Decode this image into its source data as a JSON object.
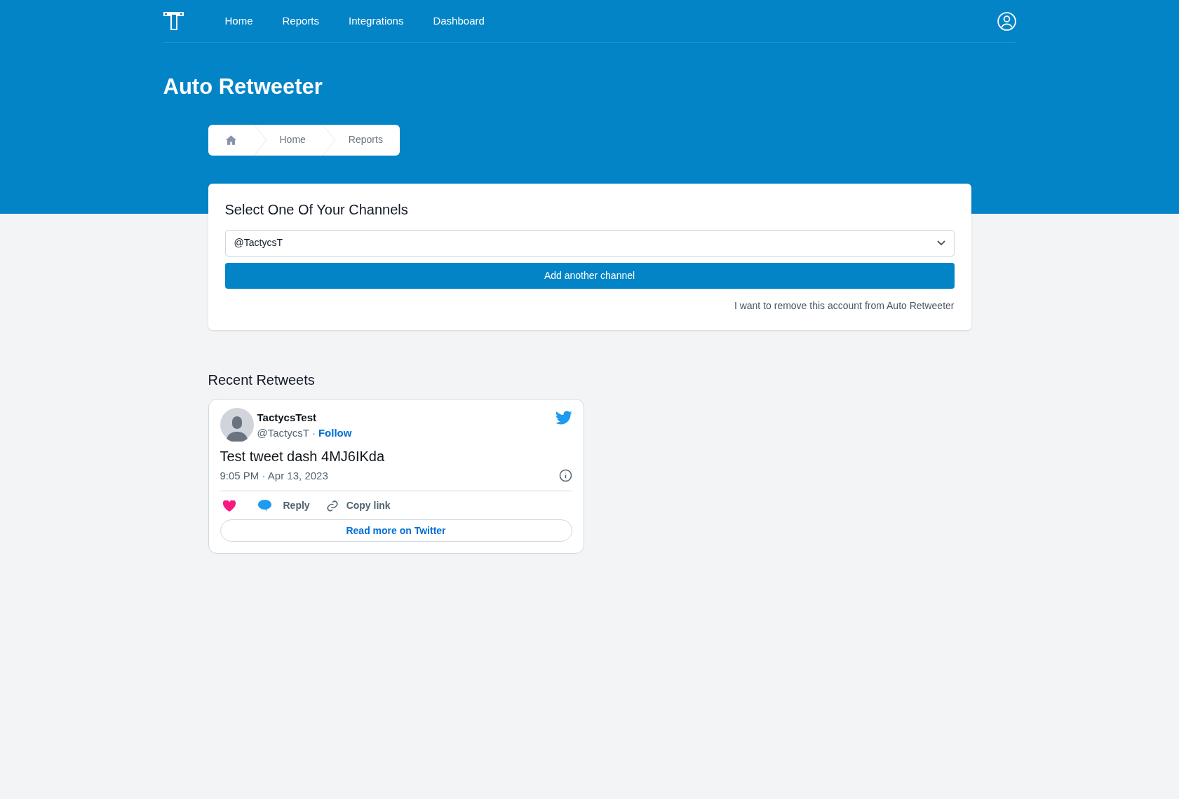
{
  "nav": {
    "items": [
      {
        "label": "Home"
      },
      {
        "label": "Reports"
      },
      {
        "label": "Integrations"
      },
      {
        "label": "Dashboard"
      }
    ]
  },
  "page_title": "Auto Retweeter",
  "breadcrumb": [
    "Home",
    "Reports"
  ],
  "channels": {
    "title": "Select One Of Your Channels",
    "value": "@TactycsT",
    "add_button": "Add another channel",
    "remove_link": "I want to remove this account from Auto Retweeter"
  },
  "recent": {
    "title": "Recent Retweets",
    "tweets": [
      {
        "name": "TactycsTest",
        "handle": "@TactycsT",
        "separator": "·",
        "follow": "Follow",
        "text": "Test tweet dash 4MJ6IKda",
        "time": "9:05 PM · Apr 13, 2023",
        "reply": "Reply",
        "copy": "Copy link",
        "read_more": "Read more on Twitter"
      }
    ]
  }
}
